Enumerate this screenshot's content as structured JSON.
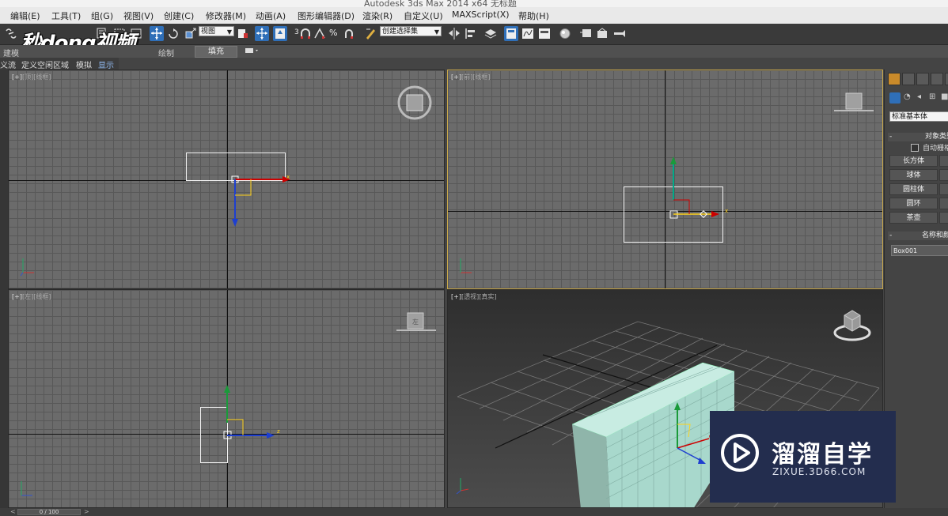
{
  "window": {
    "title": "Autodesk 3ds Max  2014 x64     无标题"
  },
  "menu": [
    "编辑(E)",
    "工具(T)",
    "组(G)",
    "视图(V)",
    "创建(C)",
    "修改器(M)",
    "动画(A)",
    "图形编辑器(D)",
    "渲染(R)",
    "自定义(U)",
    "MAXScript(X)",
    "帮助(H)"
  ],
  "toolbar": {
    "ref_coord_value": "视图",
    "selection_set_value": "创建选择集",
    "snap_3": "3",
    "snap_2_5": "2.5",
    "angle_snap": "△",
    "percent_snap": "%"
  },
  "logo_text": "秒dong视频",
  "ribbon": {
    "tab1": "建模",
    "tab_paint": "绘制",
    "fill_button": "填充"
  },
  "subtabs": [
    "义流",
    "定义空闲区域",
    "模拟",
    "显示"
  ],
  "viewports": {
    "top": {
      "bracket": "[+]",
      "view": "[顶]",
      "mode": "[线框]",
      "axis_x": "x"
    },
    "front": {
      "bracket": "[+]",
      "view": "[前]",
      "mode": "[线框]",
      "axis_x": "x"
    },
    "left": {
      "bracket": "[+]",
      "view": "[左]",
      "mode": "[线框]",
      "axis_z": "z",
      "viewcube_label": "左"
    },
    "persp": {
      "bracket": "[+]",
      "view": "[透视]",
      "mode": "[真实]"
    }
  },
  "command_panel": {
    "dropdown": "标准基本体",
    "object_type_header": "对象类型",
    "autogrid_label": "自动栅格",
    "buttons": [
      "长方体",
      "球体",
      "圆柱体",
      "圆环",
      "茶壶"
    ],
    "name_color_header": "名称和颜色",
    "object_name": "Box001"
  },
  "status": {
    "frame": "0 / 100"
  },
  "watermark": {
    "cn": "溜溜自学",
    "en": "ZIXUE.3D66.COM"
  },
  "colors": {
    "accent_active_viewport": "#c9a84a",
    "box_shaded": "#a8d8cc",
    "watermark_bg": "#232d4e"
  }
}
